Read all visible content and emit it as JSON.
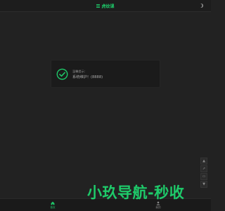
{
  "header": {
    "title": "虎纹课",
    "title_icon": "menu-bars-icon",
    "theme_toggle_icon": "moon-icon"
  },
  "notice": {
    "icon": "check-circle-icon",
    "label": "温馨提示：",
    "message": "系统维护！(8888)"
  },
  "side_tools": {
    "items": [
      {
        "icon": "up-icon",
        "glyph": "▲"
      },
      {
        "icon": "share-icon",
        "glyph": "⇗"
      },
      {
        "icon": "comment-icon",
        "glyph": "▭"
      },
      {
        "icon": "down-icon",
        "glyph": "▼"
      }
    ]
  },
  "bottom_nav": {
    "tabs": [
      {
        "label": "首页",
        "icon": "home-icon",
        "active": true
      },
      {
        "label": "我的",
        "icon": "user-icon",
        "active": false
      }
    ]
  },
  "watermark": {
    "text": "小玖导航-秒收"
  },
  "colors": {
    "accent": "#1ecb6a",
    "background": "#222222",
    "panel": "#1b1b1b"
  }
}
